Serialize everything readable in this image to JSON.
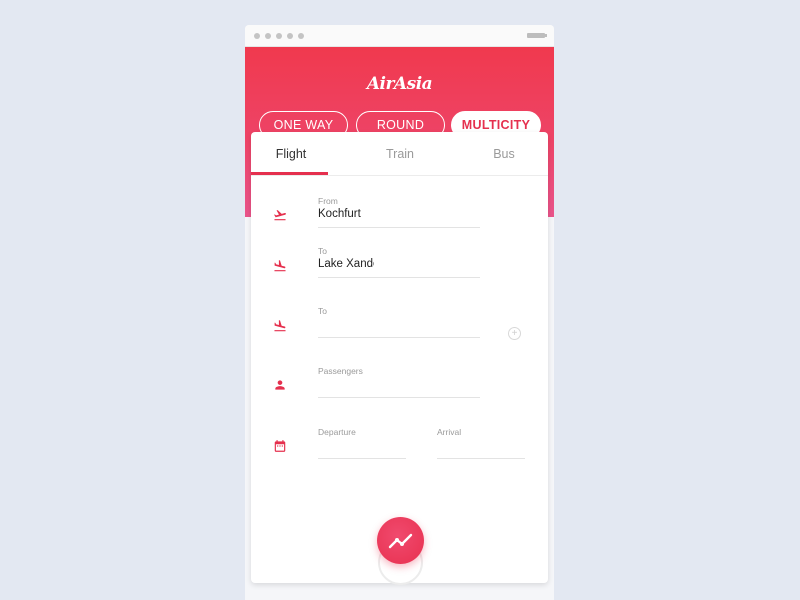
{
  "app": {
    "logo_text": "AirAsia"
  },
  "trip_types": [
    {
      "label": "ONE WAY",
      "active": false
    },
    {
      "label": "ROUND",
      "active": false
    },
    {
      "label": "MULTICITY",
      "active": true
    }
  ],
  "tabs": [
    {
      "label": "Flight",
      "active": true
    },
    {
      "label": "Train",
      "active": false
    },
    {
      "label": "Bus",
      "active": false
    }
  ],
  "form": {
    "from": {
      "label": "From",
      "value": "Kochfurt"
    },
    "to_1": {
      "label": "To",
      "value": "Lake Xande"
    },
    "to_2": {
      "label": "To",
      "value": ""
    },
    "passengers": {
      "label": "Passengers",
      "value": ""
    },
    "departure": {
      "label": "Departure",
      "value": ""
    },
    "arrival": {
      "label": "Arrival",
      "value": ""
    }
  },
  "icons": {
    "takeoff": "flight-takeoff-icon",
    "landing": "flight-land-icon",
    "person": "person-icon",
    "calendar": "calendar-icon",
    "add": "add-circle-icon",
    "trend": "trend-icon"
  },
  "colors": {
    "accent": "#e5304e",
    "header_top": "#f0394e",
    "header_bottom": "#e9548b"
  }
}
